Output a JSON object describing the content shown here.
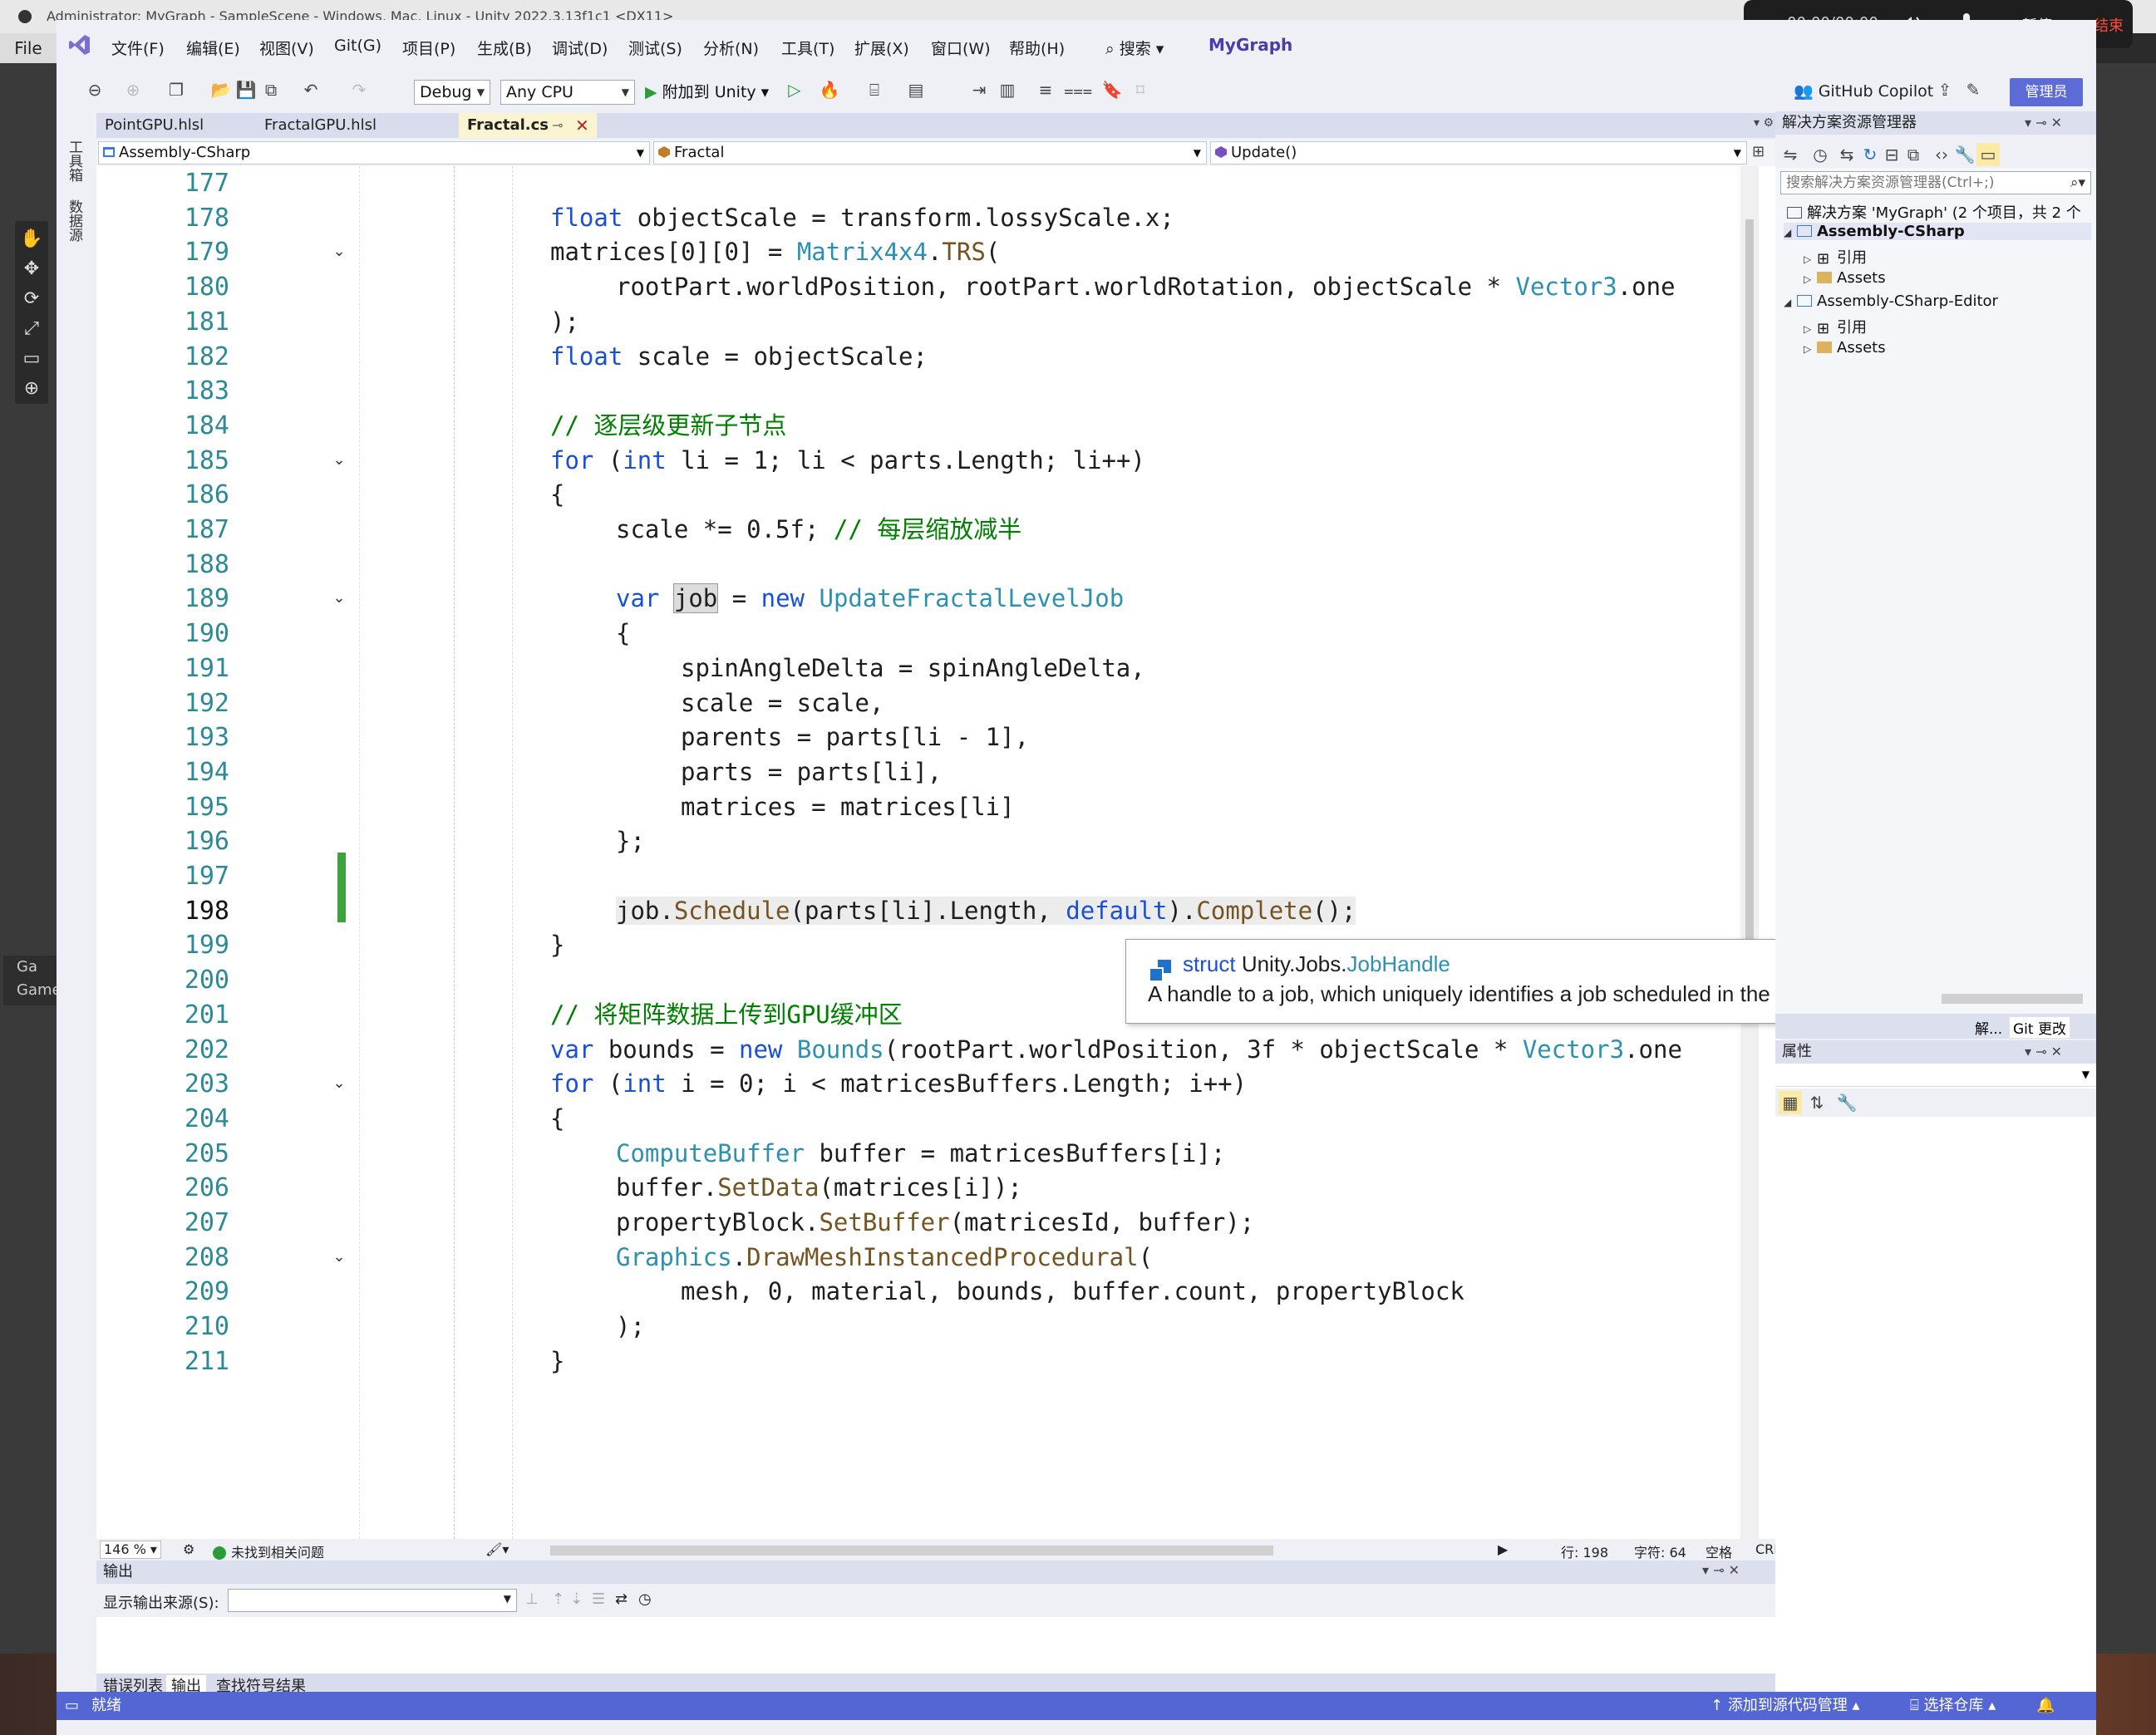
{
  "unity": {
    "title": "Administrator: MyGraph - SampleScene - Windows, Mac, Linux - Unity 2022.3.13f1c1 <DX11>",
    "file_menu": "File",
    "game_tab": "Game",
    "game_tab_short": "Ga"
  },
  "recorder": {
    "time": "00:00/00:00",
    "pause": "暂停",
    "end": "结束"
  },
  "vs": {
    "menu": [
      "文件(F)",
      "编辑(E)",
      "视图(V)",
      "Git(G)",
      "项目(P)",
      "生成(B)",
      "调试(D)",
      "测试(S)",
      "分析(N)",
      "工具(T)",
      "扩展(X)",
      "窗口(W)",
      "帮助(H)"
    ],
    "search_label": "搜索",
    "project_name": "MyGraph",
    "toolbar": {
      "config": "Debug",
      "platform": "Any CPU",
      "attach": "附加到 Unity",
      "copilot": "GitHub Copilot",
      "admin": "管理员"
    },
    "side_tabs": [
      "工具箱",
      "数据源"
    ],
    "tabs": [
      "PointGPU.hlsl",
      "FractalGPU.hlsl",
      "Fractal.cs"
    ],
    "nav": {
      "project": "Assembly-CSharp",
      "class": "Fractal",
      "member": "Update()"
    },
    "code": {
      "lines": [
        "177",
        "178",
        "179",
        "180",
        "181",
        "182",
        "183",
        "184",
        "185",
        "186",
        "187",
        "188",
        "189",
        "190",
        "191",
        "192",
        "193",
        "194",
        "195",
        "196",
        "197",
        "198",
        "199",
        "200",
        "201",
        "202",
        "203",
        "204",
        "205",
        "206",
        "207",
        "208",
        "209",
        "210",
        "211"
      ],
      "comment_update_children": "// 逐层级更新子节点",
      "comment_half_scale": "// 每层缩放减半",
      "comment_upload_gpu": "// 将矩阵数据上传到GPU缓冲区"
    },
    "tooltip": {
      "kind": "struct",
      "namespace": "Unity.Jobs.",
      "type": "JobHandle",
      "description": "A handle to a job, which uniquely identifies a job scheduled in the job system."
    },
    "editor_status": {
      "zoom": "146 %",
      "issues": "未找到相关问题",
      "row": "行: 198",
      "col": "字符: 64",
      "spacing": "空格",
      "eol": "CRLF"
    },
    "output": {
      "title": "输出",
      "source_label": "显示输出来源(S):",
      "source_value": "",
      "tabs": [
        "错误列表",
        "输出",
        "查找符号结果"
      ]
    },
    "statusbar": {
      "ready": "就绪",
      "add_source_control": "添加到源代码管理",
      "select_repo": "选择仓库"
    },
    "solution_explorer": {
      "title": "解决方案资源管理器",
      "search_placeholder": "搜索解决方案资源管理器(Ctrl+;)",
      "solution": "解决方案 'MyGraph' (2 个项目，共 2 个",
      "items": [
        {
          "label": "Assembly-CSharp",
          "bold": true
        },
        {
          "label": "引用"
        },
        {
          "label": "Assets"
        },
        {
          "label": "Assembly-CSharp-Editor"
        },
        {
          "label": "引用"
        },
        {
          "label": "Assets"
        }
      ],
      "bottom_tab_left": "解...",
      "bottom_tab_git": "Git 更改"
    },
    "properties": {
      "title": "属性"
    }
  }
}
